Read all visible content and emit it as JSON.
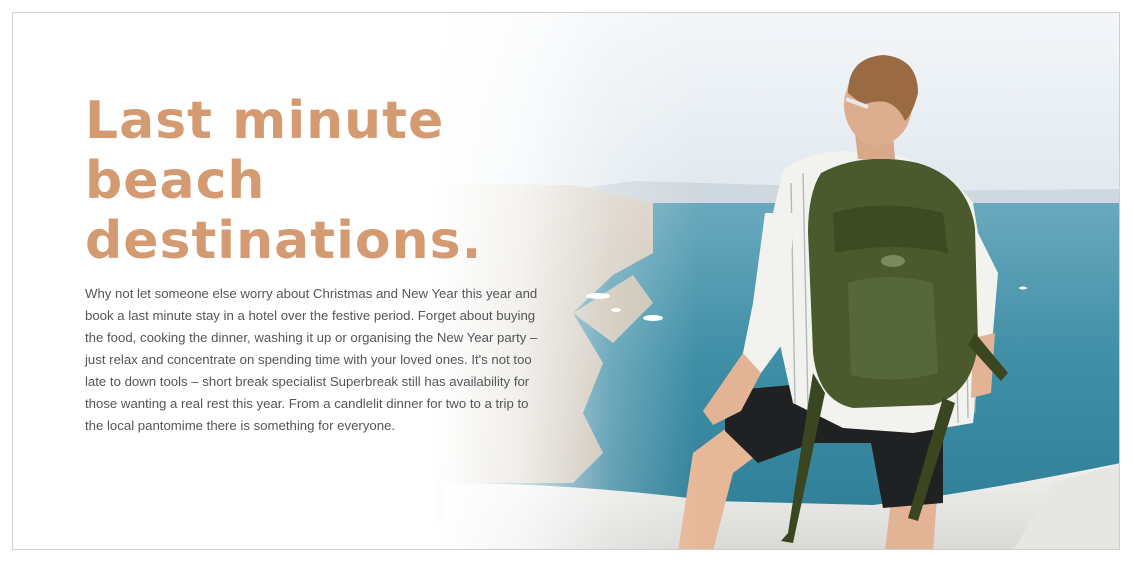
{
  "article": {
    "headline_line1": "Last minute beach",
    "headline_line2": "destinations.",
    "body": "Why not let someone else worry about Christmas and New Year this year and book a last minute stay in a hotel over the festive period. Forget about buying the food, cooking the dinner, washing it up or organising the New Year party – just relax and concentrate on spending time with your loved ones. It's not too late to down tools – short break specialist Superbreak still has availability for those wanting a real rest this year. From a candlelit dinner for two to a trip to the local pantomime there is something for everyone."
  },
  "colors": {
    "headline": "#d49a72",
    "body_text": "#555555",
    "sea": "#3e8ea6",
    "backpack": "#4b5a2c"
  },
  "image": {
    "icon": "hiker-with-backpack-overlooking-sea-photo"
  }
}
